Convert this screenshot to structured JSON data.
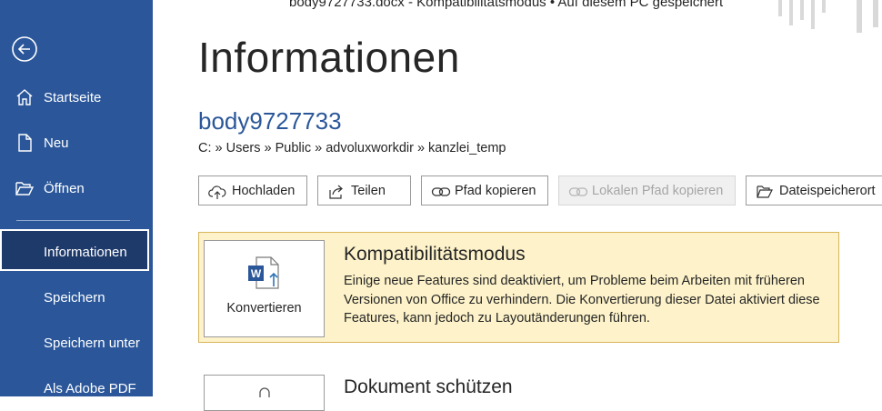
{
  "window": {
    "title": "body9727733.docx  -  Kompatibilitätsmodus • Auf  diesem PC  gespeichert"
  },
  "sidebar": {
    "items": [
      {
        "label": "Startseite",
        "icon": "home-icon"
      },
      {
        "label": "Neu",
        "icon": "new-document-icon"
      },
      {
        "label": "Öffnen",
        "icon": "folder-open-icon"
      },
      {
        "label": "Informationen"
      },
      {
        "label": "Speichern"
      },
      {
        "label": "Speichern unter"
      },
      {
        "label": "Als Adobe PDF"
      }
    ],
    "active": "Informationen",
    "colors": {
      "background": "#2b579a",
      "active_bg": "#1e3a6b"
    }
  },
  "page": {
    "title": "Informationen",
    "doc_name": "body9727733",
    "path": "C: » Users » Public » advoluxworkdir » kanzlei_temp"
  },
  "actions": {
    "upload": "Hochladen",
    "share": "Teilen",
    "copy_path": "Pfad kopieren",
    "copy_local_path": "Lokalen Pfad kopieren",
    "file_location": "Dateispeicherort"
  },
  "compat": {
    "button_label": "Konvertieren",
    "title": "Kompatibilitätsmodus",
    "description": "Einige neue Features sind deaktiviert, um Probleme beim Arbeiten mit früheren Versionen von Office zu verhindern. Die Konvertierung dieser Datei aktiviert diese Features, kann jedoch zu Layoutänderungen führen.",
    "colors": {
      "background": "#fdf2c9",
      "border": "#d9b65d"
    }
  },
  "protect": {
    "title": "Dokument schützen"
  }
}
